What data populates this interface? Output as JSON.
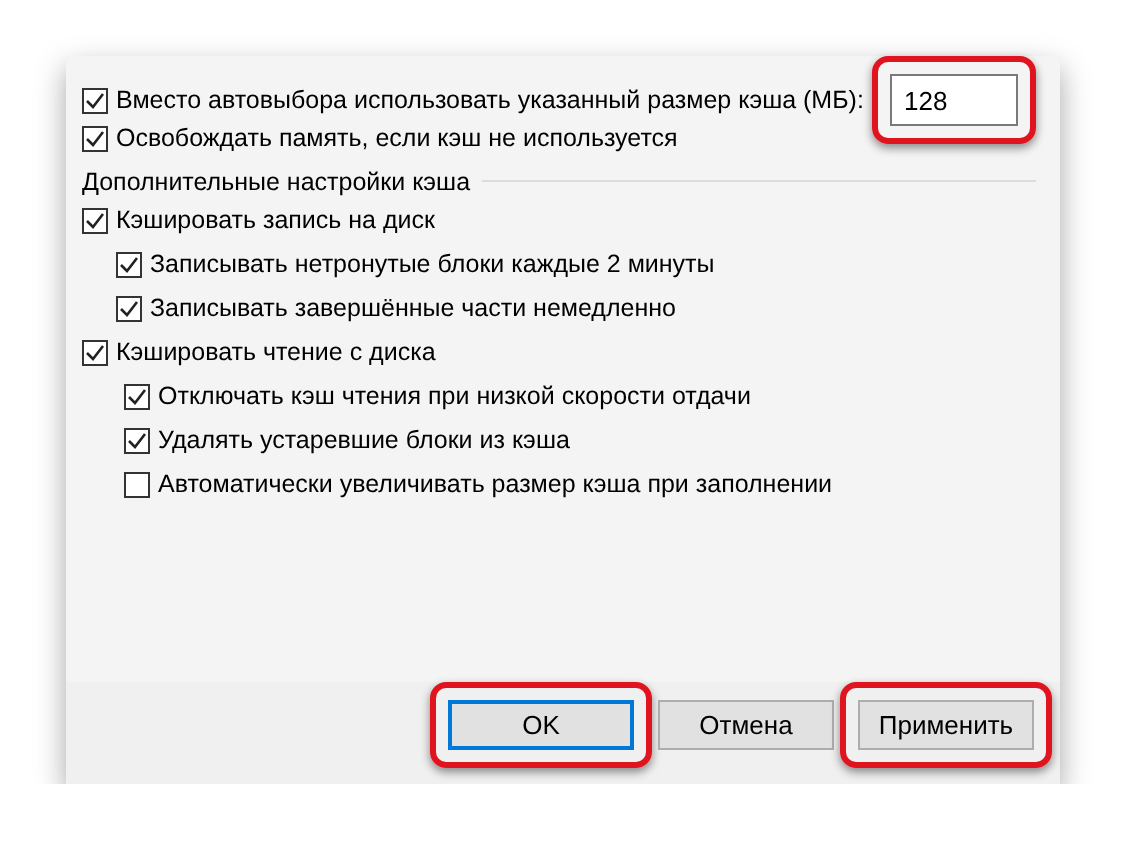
{
  "cache_size": {
    "label": "Вместо автовыбора использовать указанный размер кэша (МБ):",
    "checked": true,
    "value": "128",
    "highlighted": true
  },
  "free_memory": {
    "label": "Освобождать память, если кэш не используется",
    "checked": true
  },
  "group": {
    "title": "Дополнительные настройки кэша",
    "items": [
      {
        "label": "Кэшировать запись на диск",
        "checked": true,
        "children": [
          {
            "label": "Записывать нетронутые блоки каждые 2 минуты",
            "checked": true
          },
          {
            "label": "Записывать завершённые части немедленно",
            "checked": true
          }
        ]
      },
      {
        "label": "Кэшировать чтение с диска",
        "checked": true,
        "children": [
          {
            "label": "Отключать кэш чтения при низкой скорости отдачи",
            "checked": true
          },
          {
            "label": "Удалять устаревшие блоки из кэша",
            "checked": true
          },
          {
            "label": "Автоматически увеличивать размер кэша при заполнении",
            "checked": false
          }
        ]
      }
    ]
  },
  "buttons": [
    {
      "label": "OK",
      "default": true,
      "highlighted": true
    },
    {
      "label": "Отмена",
      "default": false,
      "highlighted": false
    },
    {
      "label": "Применить",
      "default": false,
      "highlighted": true
    }
  ]
}
